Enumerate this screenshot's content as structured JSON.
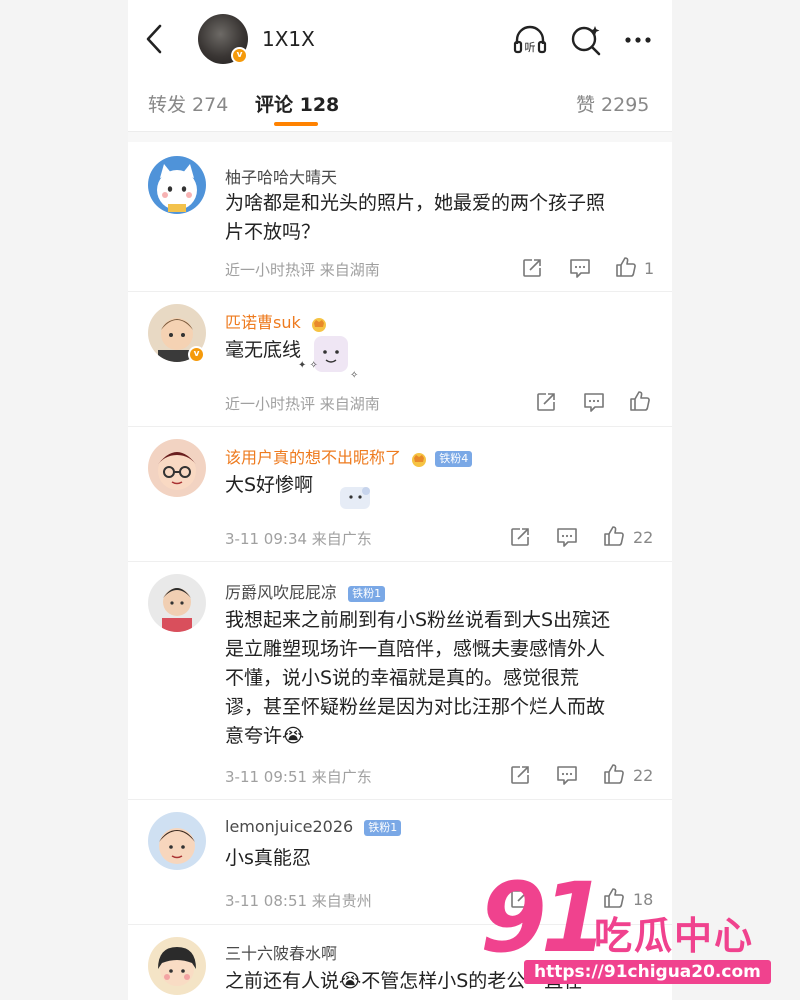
{
  "header": {
    "title": "1X1X",
    "vip_badge": "v",
    "listen_label": "听"
  },
  "tabs": [
    {
      "label": "转发 274"
    },
    {
      "label": "评论 128"
    },
    {
      "label": "赞 2295"
    }
  ],
  "colors": {
    "accent": "#ff8200",
    "gold_name": "#ee7b1f",
    "fan_badge": "#7aa8e6",
    "watermark": "#f0428e"
  },
  "comments": [
    {
      "name": "柚子哈哈大晴天",
      "text": [
        "为啥都是和光头的照片，她最爱的两个孩子照",
        "片不放吗？"
      ],
      "meta": "近一小时热评  来自湖南",
      "likes": "1"
    },
    {
      "name": "匹诺曹suk",
      "text": [
        "毫无底线"
      ],
      "meta": "近一小时热评  来自湖南",
      "likes": ""
    },
    {
      "name": "该用户真的想不出昵称了",
      "badge": "铁粉4",
      "text": [
        "大S好惨啊"
      ],
      "meta": "3-11 09:34  来自广东",
      "likes": "22"
    },
    {
      "name": "厉爵风吹屁屁凉",
      "badge": "铁粉1",
      "text": [
        "我想起来之前刷到有小S粉丝说看到大S出殡还",
        "是立雕塑现场许一直陪伴，感慨夫妻感情外人",
        "不懂，说小S说的幸福就是真的。感觉很荒",
        "谬，甚至怀疑粉丝是因为对比汪那个烂人而故",
        "意夸许😭"
      ],
      "meta": "3-11 09:51  来自广东",
      "likes": "22"
    },
    {
      "name": "lemonjuice2026",
      "badge": "铁粉1",
      "text": [
        "小s真能忍"
      ],
      "meta": "3-11 08:51  来自贵州",
      "likes": "18"
    },
    {
      "name": "三十六陂春水啊",
      "text": [
        "之前还有人说😭不管怎样小S的老公一直在"
      ],
      "meta": "",
      "likes": ""
    }
  ],
  "watermark": {
    "number": "91",
    "text": "吃瓜中心",
    "url": "https://91chigua20.com"
  }
}
